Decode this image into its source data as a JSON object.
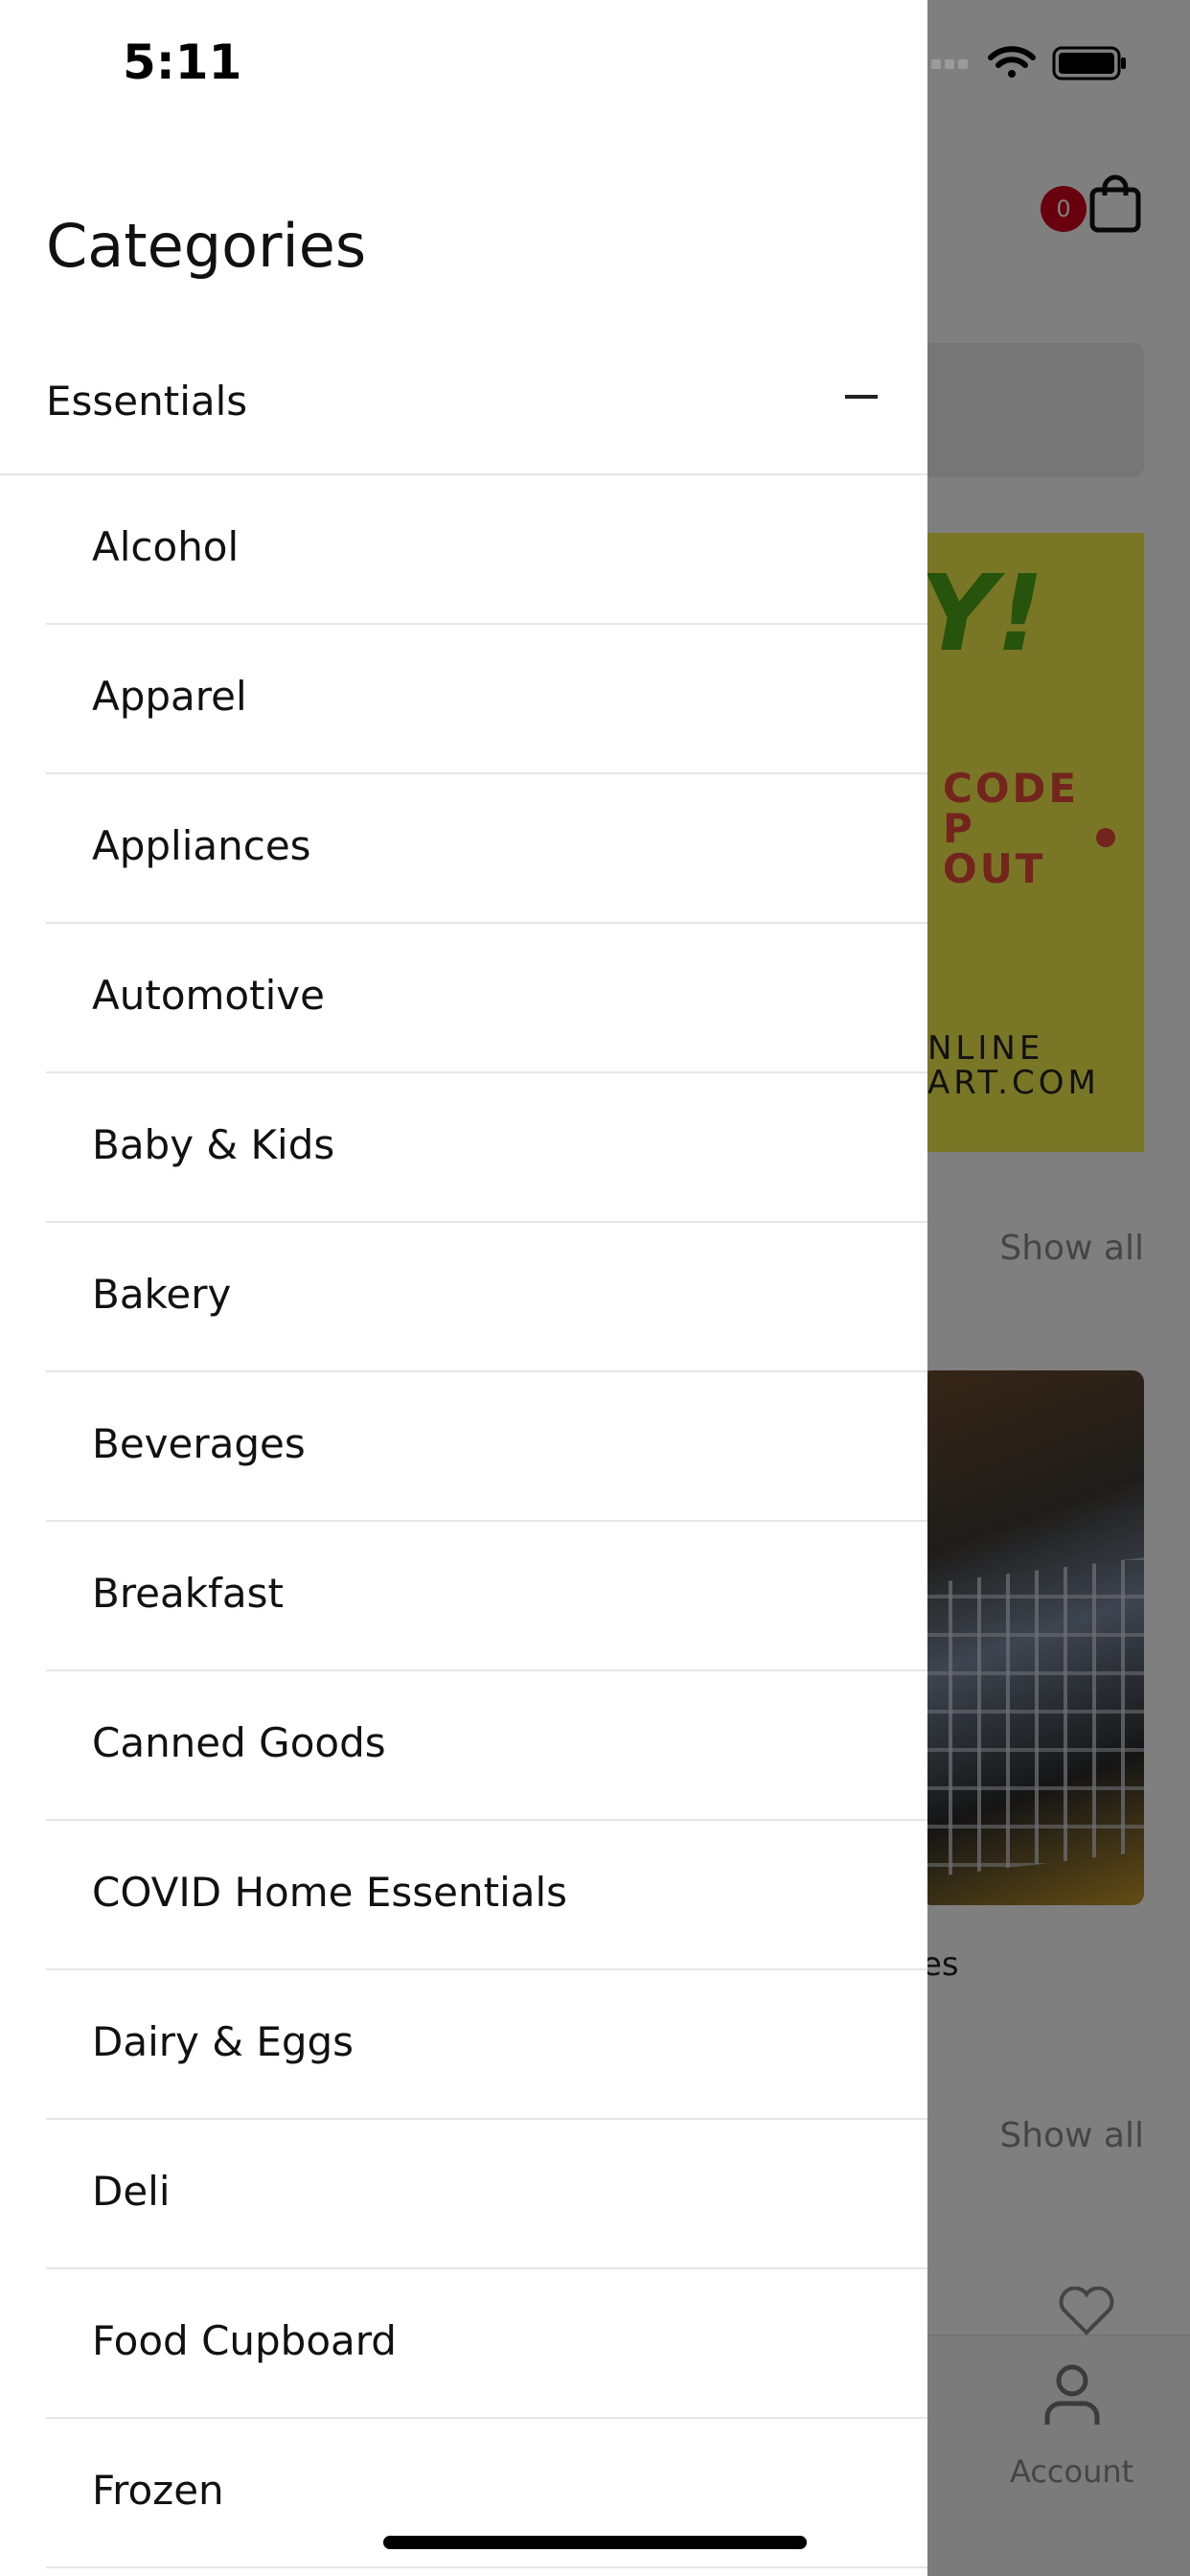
{
  "status_bar": {
    "time": "5:11"
  },
  "background_app": {
    "cart_count": "0",
    "banner": {
      "line1": "Y!",
      "line2": "CODE\nP\nOUT",
      "line3": "NLINE\nART.COM"
    },
    "show_all_1": "Show all",
    "show_all_2": "Show all",
    "photo_caption": "es",
    "tab_account_label": "Account"
  },
  "drawer": {
    "title": "Categories",
    "group": {
      "label": "Essentials",
      "expanded": true
    },
    "items": [
      {
        "label": "Alcohol"
      },
      {
        "label": "Apparel"
      },
      {
        "label": "Appliances"
      },
      {
        "label": "Automotive"
      },
      {
        "label": "Baby & Kids"
      },
      {
        "label": "Bakery"
      },
      {
        "label": "Beverages"
      },
      {
        "label": "Breakfast"
      },
      {
        "label": "Canned Goods"
      },
      {
        "label": "COVID Home Essentials"
      },
      {
        "label": "Dairy & Eggs"
      },
      {
        "label": "Deli"
      },
      {
        "label": "Food Cupboard"
      },
      {
        "label": "Frozen"
      }
    ]
  },
  "colors": {
    "badge": "#d0021b",
    "banner_bg": "#f3ec4a",
    "banner_green": "#4fa81a",
    "banner_red": "#e4483b"
  }
}
